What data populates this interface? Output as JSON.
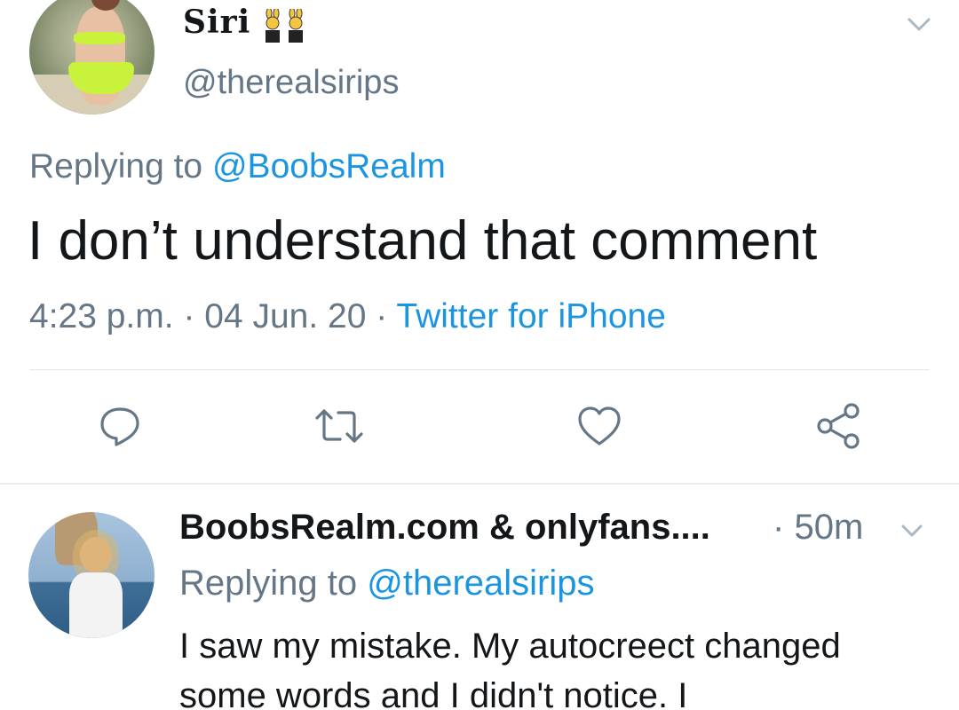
{
  "tweet": {
    "display_name": "Siri",
    "name_emoji": "people-with-bunny-ears-emoji",
    "handle": "@therealsirips",
    "replying_prefix": "Replying to",
    "replying_mention": "@BoobsRealm",
    "text": "I don’t understand that comment",
    "time": "4:23 p.m.",
    "separator": "·",
    "date": "04 Jun. 20",
    "source": "Twitter for iPhone"
  },
  "actions": [
    "reply-icon",
    "retweet-icon",
    "like-icon",
    "share-icon"
  ],
  "reply": {
    "display_name": "BoobsRealm.com & onlyfans....",
    "separator": "·",
    "time": "50m",
    "replying_prefix": "Replying to",
    "replying_mention": "@therealsirips",
    "text": "I saw my mistake. My autocreect changed some words and I didn't notice. I"
  },
  "colors": {
    "text": "#14171a",
    "secondary": "#657786",
    "link": "#1b95e0",
    "divider": "#e1e8ed"
  }
}
